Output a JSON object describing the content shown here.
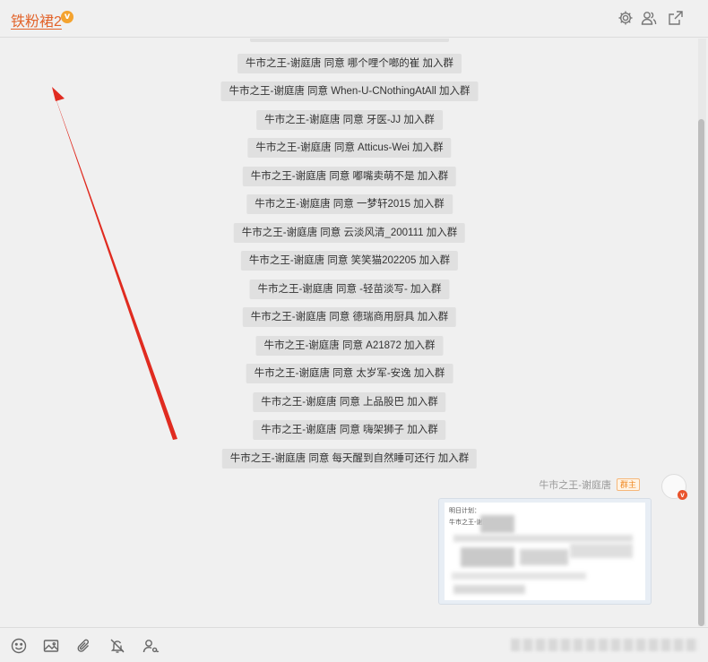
{
  "header": {
    "title": "铁粉裙2",
    "badge_text": "v",
    "icons": [
      "gear-icon",
      "members-icon",
      "popout-icon"
    ]
  },
  "messages": [
    "牛市之王-谢庭唐 同意 哪个哩个啷的崔 加入群",
    "牛市之王-谢庭唐 同意 When-U-CNothingAtAll 加入群",
    "牛市之王-谢庭唐 同意 牙医-JJ 加入群",
    "牛市之王-谢庭唐 同意 Atticus-Wei 加入群",
    "牛市之王-谢庭唐 同意 嘟嘴卖萌不是 加入群",
    "牛市之王-谢庭唐 同意 一梦轩2015 加入群",
    "牛市之王-谢庭唐 同意 云淡风清_200111 加入群",
    "牛市之王-谢庭唐 同意 笑笑猫202205 加入群",
    "牛市之王-谢庭唐 同意 -轻苗淡写- 加入群",
    "牛市之王-谢庭唐 同意 德瑞商用厨具 加入群",
    "牛市之王-谢庭唐 同意 A21872 加入群",
    "牛市之王-谢庭唐 同意 太岁军-安逸 加入群",
    "牛市之王-谢庭唐 同意 上品股巴 加入群",
    "牛市之王-谢庭唐 同意 嗨架狮子 加入群",
    "牛市之王-谢庭唐 同意 每天醒到自然睡可还行 加入群"
  ],
  "last_message": {
    "sender": "牛市之王-谢庭唐",
    "role_badge": "群主",
    "avatar_badge": "v",
    "image_lines": [
      "明日计划：",
      "牛市之王-谢庭唐 先生"
    ]
  },
  "footer": {
    "icons": [
      "emoji-icon",
      "image-icon",
      "attachment-icon",
      "mute-icon",
      "mention-icon"
    ]
  },
  "colors": {
    "accent": "#e2632a",
    "arrow": "#e02b20",
    "pill_bg": "#e0e0e0",
    "badge_orange": "#f4a32f"
  }
}
